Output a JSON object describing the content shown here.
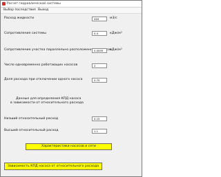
{
  "window": {
    "title": "Расчет гидравлической системы"
  },
  "menu": {
    "items": [
      "Выбор последствия",
      "Выход"
    ]
  },
  "form": {
    "flow": {
      "label": "Расход жидкости",
      "value": "440",
      "unit": "м3/с"
    },
    "network_resistance": {
      "label": "Сопротивление системы",
      "value": "0.4",
      "unit": "кДж/м³"
    },
    "parallel_resistance": {
      "label": "Сопротивление участка параллельно расположенных насосов",
      "value": "0.0005",
      "unit": "кДж/м³"
    },
    "pump_count": {
      "label": "Число одновременно работающих насосов",
      "value": "2"
    },
    "flow_fraction": {
      "label": "Доля расхода при отключении одного насоса",
      "value": "0.75"
    },
    "note": {
      "line1": "Данные для определения КПД насоса",
      "line2": "в зависимости от относительного расхода"
    },
    "low_relative_flow": {
      "label": "Низший относительный расход",
      "value": "0.15"
    },
    "high_relative_flow": {
      "label": "Высший относительный расход",
      "value": "1.1"
    }
  },
  "buttons": {
    "characteristics": "Характеристики насосов и сети",
    "efficiency": "Зависимость КПД насоса от относительного расхода"
  },
  "colors": {
    "button_bg": "#ffff00",
    "window_bg": "#f0f0f0"
  }
}
